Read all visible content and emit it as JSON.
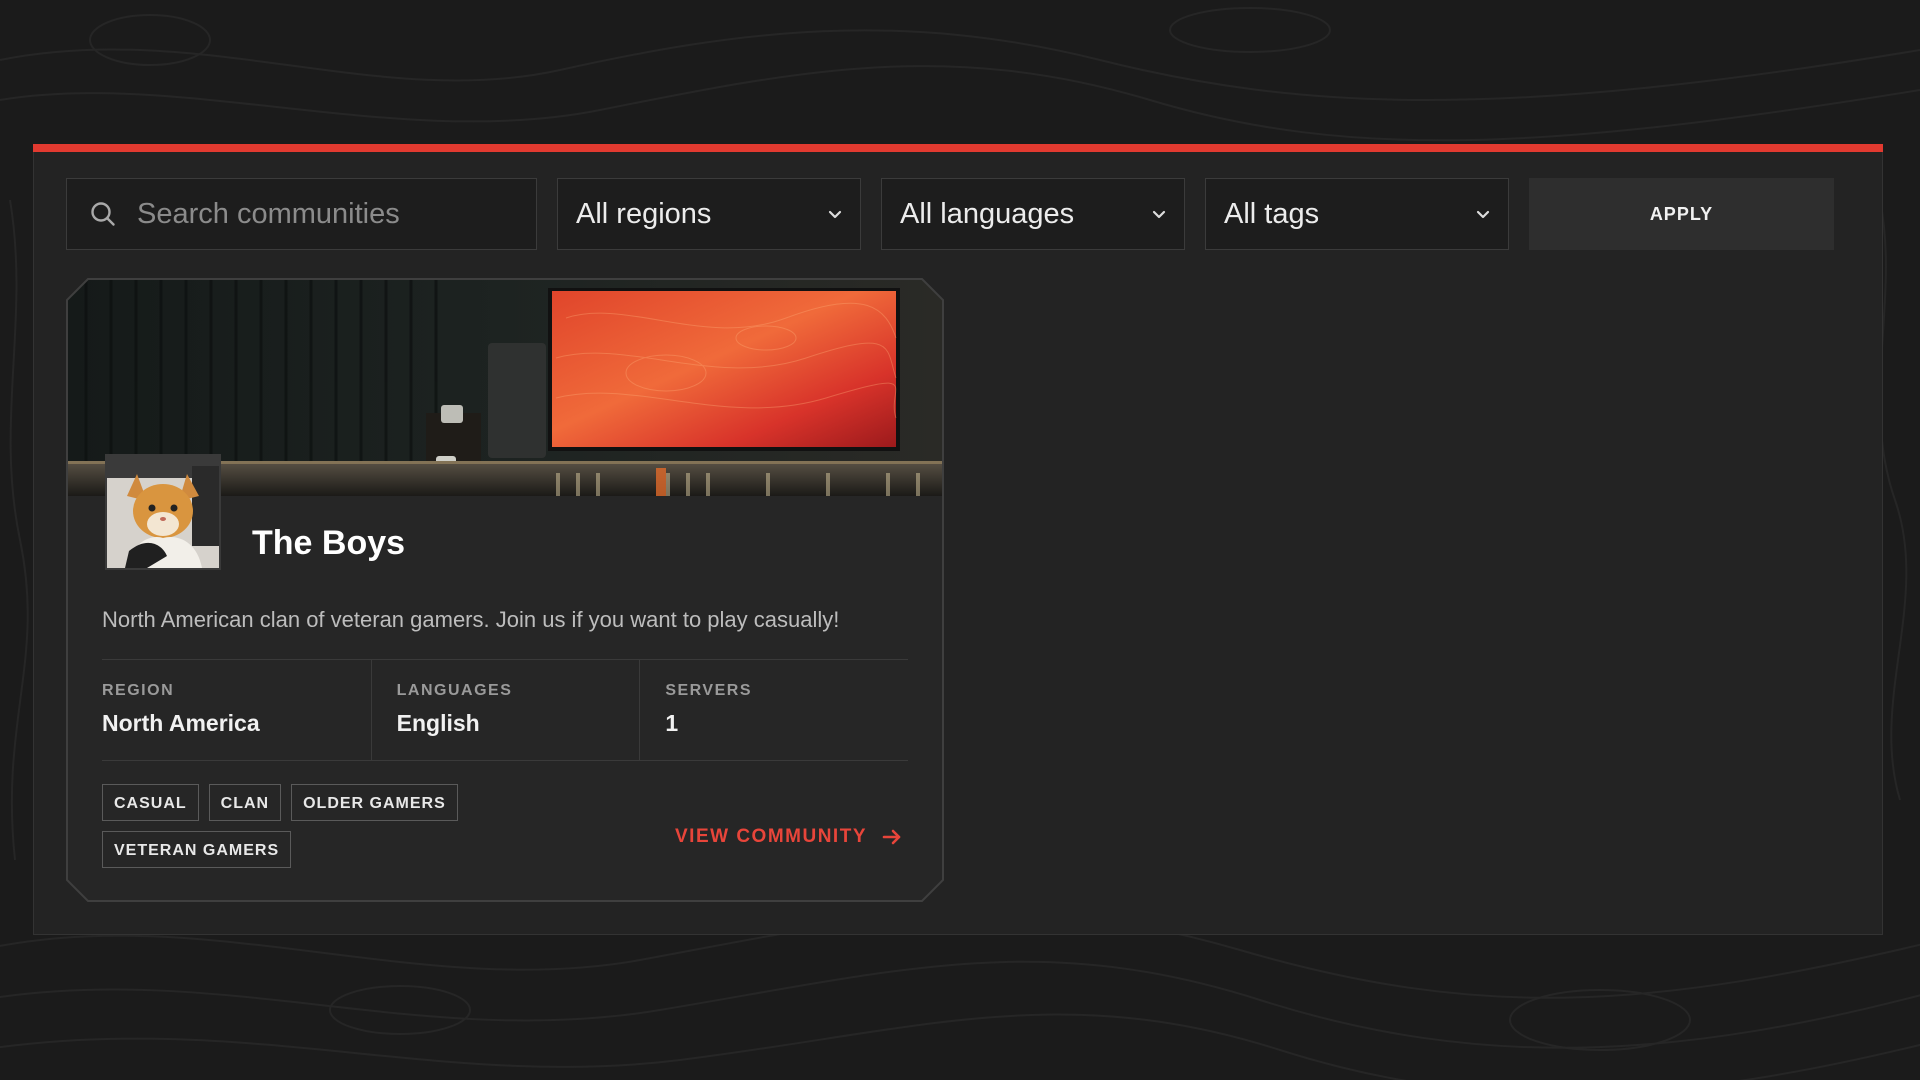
{
  "filters": {
    "search_placeholder": "Search communities",
    "region": "All regions",
    "language": "All languages",
    "tags": "All tags",
    "apply_label": "APPLY"
  },
  "community": {
    "name": "The Boys",
    "description": "North American clan of veteran gamers. Join us if you want to play casually!",
    "stats": [
      {
        "label": "REGION",
        "value": "North America"
      },
      {
        "label": "LANGUAGES",
        "value": "English"
      },
      {
        "label": "SERVERS",
        "value": "1"
      }
    ],
    "tags": [
      "CASUAL",
      "CLAN",
      "OLDER GAMERS",
      "VETERAN GAMERS"
    ],
    "view_label": "VIEW COMMUNITY"
  },
  "colors": {
    "accent": "#e23a30",
    "link": "#e8453a",
    "panel": "#232323",
    "page_bg": "#1b1b1b"
  },
  "icons": {
    "search": "search-icon",
    "dropdown": "chevron-down-icon",
    "link_arrow": "arrow-right-icon"
  }
}
